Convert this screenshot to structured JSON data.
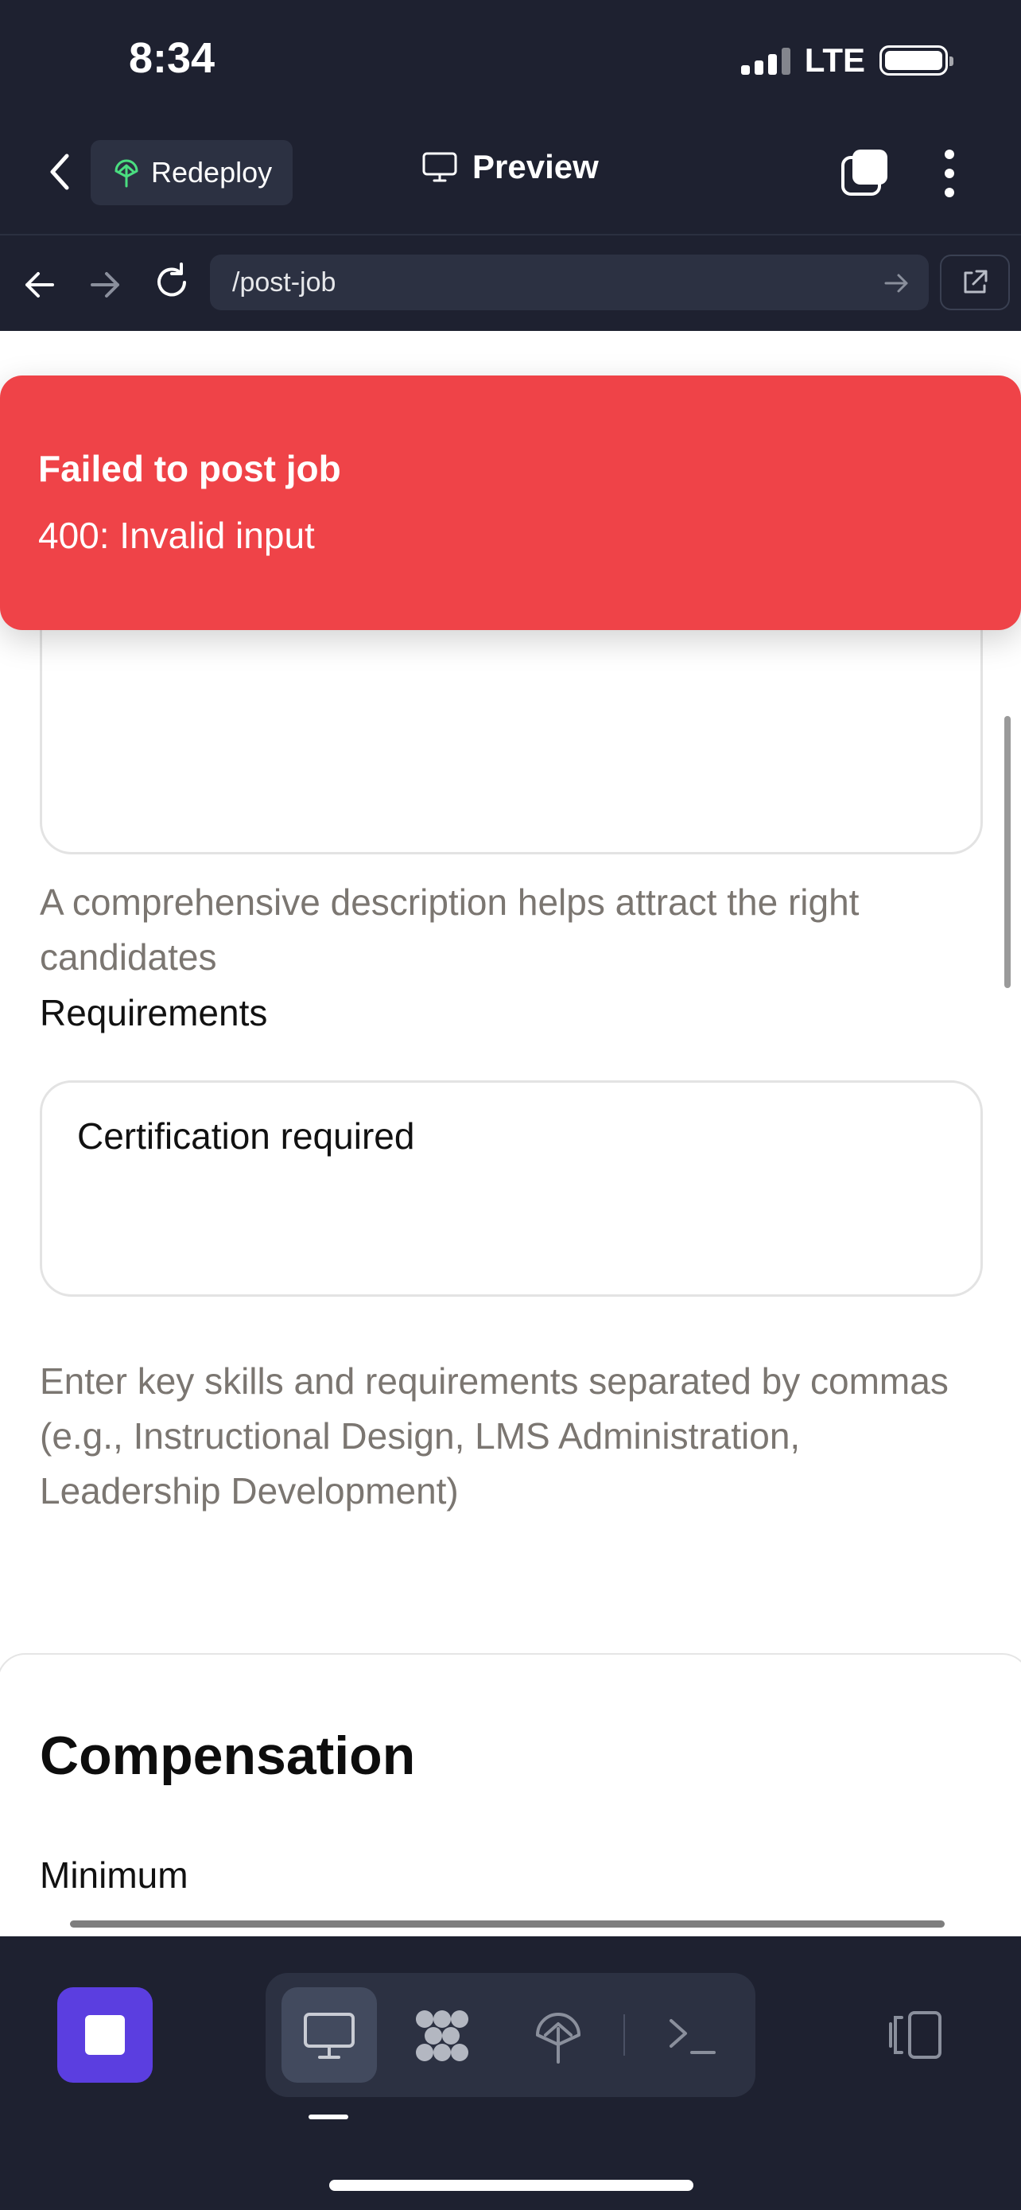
{
  "status_bar": {
    "time": "8:34",
    "network": "LTE"
  },
  "header": {
    "redeploy_label": "Redeploy",
    "preview_label": "Preview"
  },
  "url_bar": {
    "path": "/post-job"
  },
  "toast": {
    "title": "Failed to post job",
    "message": "400: Invalid input",
    "color": "#ef4348"
  },
  "form": {
    "description_help": "A comprehensive description helps attract the right candidates",
    "requirements_label": "Requirements",
    "requirements_value": "Certification required",
    "requirements_help": "Enter key skills and requirements separated by commas (e.g., Instructional Design, LMS Administration, Leadership Development)",
    "compensation_title": "Compensation",
    "minimum_label": "Minimum"
  },
  "dock": {
    "icons": [
      "monitor-icon",
      "grid-icon",
      "deploy-icon",
      "terminal-icon",
      "panel-toggle-icon"
    ],
    "accent": "#5b3ee0"
  }
}
